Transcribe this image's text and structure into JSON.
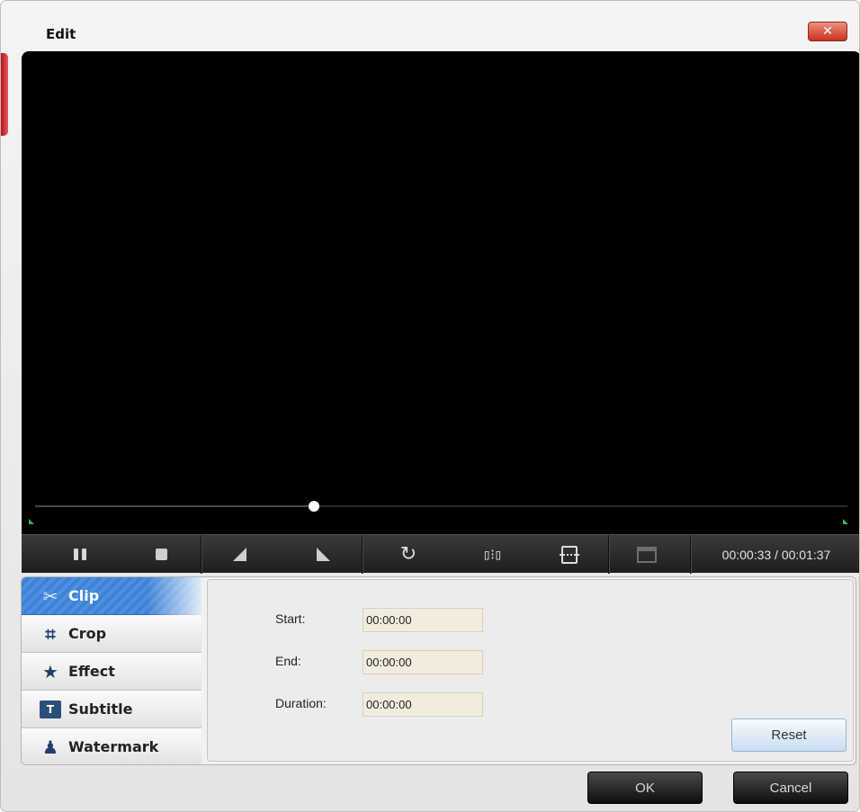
{
  "window": {
    "title": "Edit",
    "close_glyph": "✕"
  },
  "player": {
    "playhead_fraction": 0.343,
    "timecode": "00:00:33 / 00:01:37",
    "icons": [
      "pause-icon",
      "stop-icon",
      "rotate-left-icon",
      "rotate-right-icon",
      "rotate-cw-icon",
      "flip-horizontal-icon",
      "flip-vertical-icon",
      "clapperboard-icon"
    ]
  },
  "tabs": [
    {
      "label": "Clip",
      "icon": "scissors-icon",
      "active": true
    },
    {
      "label": "Crop",
      "icon": "crop-icon",
      "active": false
    },
    {
      "label": "Effect",
      "icon": "star-icon",
      "active": false
    },
    {
      "label": "Subtitle",
      "icon": "subtitle-icon",
      "active": false
    },
    {
      "label": "Watermark",
      "icon": "stamp-icon",
      "active": false
    }
  ],
  "clip": {
    "start_label": "Start:",
    "start_value": "00:00:00",
    "end_label": "End:",
    "end_value": "00:00:00",
    "duration_label": "Duration:",
    "duration_value": "00:00:00",
    "reset_label": "Reset"
  },
  "buttons": {
    "ok": "OK",
    "cancel": "Cancel"
  },
  "colors": {
    "accent": "#3f81d5",
    "close": "#c8341c",
    "marker": "#2fb84a"
  }
}
